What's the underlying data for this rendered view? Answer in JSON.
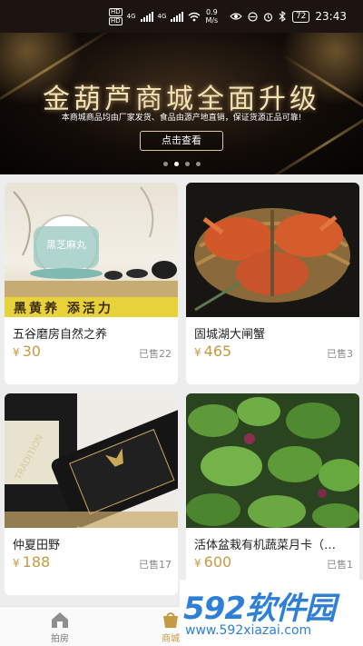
{
  "status_bar": {
    "hd1": "HD",
    "hd2": "HD",
    "net1": "4G",
    "net2": "4G",
    "speed_value": "0.9",
    "speed_unit": "M/s",
    "battery": "72",
    "time": "23:43"
  },
  "banner": {
    "title": "金葫芦商城全面升级",
    "subtitle": "本商城商品均由厂家发货、食品由源产地直销，保证货源正品可靠!",
    "button_label": "点击查看",
    "page_count": 4,
    "active_page": 2
  },
  "products": [
    {
      "name": "五谷磨房自然之养",
      "currency": "¥",
      "price": "30",
      "sold": "已售22",
      "image_label": "黑芝麻丸",
      "image_caption": "黑黄养 添活力"
    },
    {
      "name": "固城湖大闸蟹",
      "currency": "¥",
      "price": "465",
      "sold": "已售3"
    },
    {
      "name": "仲夏田野",
      "currency": "¥",
      "price": "188",
      "sold": "已售17",
      "image_label": "TRADITION"
    },
    {
      "name": "活体盆栽有机蔬菜月卡（…",
      "currency": "¥",
      "price": "600",
      "sold": "已售1"
    }
  ],
  "nav": {
    "items": [
      {
        "label": "拍房",
        "icon": "home-icon"
      },
      {
        "label": "商城",
        "icon": "mall-icon"
      }
    ]
  },
  "watermark": {
    "number": "592",
    "text": "软件园",
    "url": "www.592xiazai.com"
  },
  "colors": {
    "accent": "#c59a44",
    "watermark": "#2e7fd6",
    "banner_text": "#f3e2b6"
  }
}
